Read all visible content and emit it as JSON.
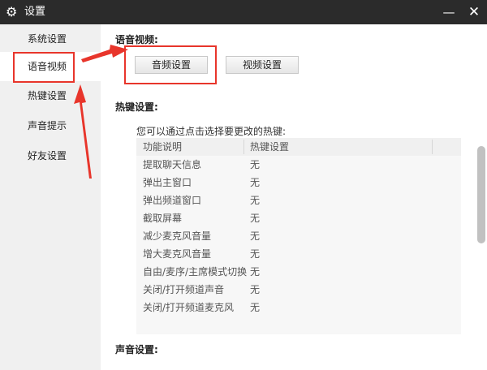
{
  "window": {
    "title": "设置"
  },
  "sidebar": {
    "items": [
      {
        "label": "系统设置"
      },
      {
        "label": "语音视频"
      },
      {
        "label": "热键设置"
      },
      {
        "label": "声音提示"
      },
      {
        "label": "好友设置"
      }
    ],
    "active_index": 1
  },
  "voice_video": {
    "title": "语音视频:",
    "audio_button": "音频设置",
    "video_button": "视频设置"
  },
  "hotkeys": {
    "title": "热键设置:",
    "description": "您可以通过点击选择要更改的热键:",
    "columns": [
      "功能说明",
      "热键设置"
    ],
    "rows": [
      {
        "function": "提取聊天信息",
        "key": "无"
      },
      {
        "function": "弹出主窗口",
        "key": "无"
      },
      {
        "function": "弹出频道窗口",
        "key": "无"
      },
      {
        "function": "截取屏幕",
        "key": "无"
      },
      {
        "function": "减少麦克风音量",
        "key": "无"
      },
      {
        "function": "增大麦克风音量",
        "key": "无"
      },
      {
        "function": "自由/麦序/主席模式切换",
        "key": "无"
      },
      {
        "function": "关闭/打开频道声音",
        "key": "无"
      },
      {
        "function": "关闭/打开频道麦克风",
        "key": "无"
      }
    ]
  },
  "sound": {
    "title": "声音设置:"
  },
  "icons": {
    "title_icon": "gear-icon",
    "minimize": "minimize-icon",
    "close": "close-icon"
  },
  "colors": {
    "titlebar": "#2b2b2b",
    "sidebar": "#f0f0f0",
    "annotation": "#e8352b"
  }
}
